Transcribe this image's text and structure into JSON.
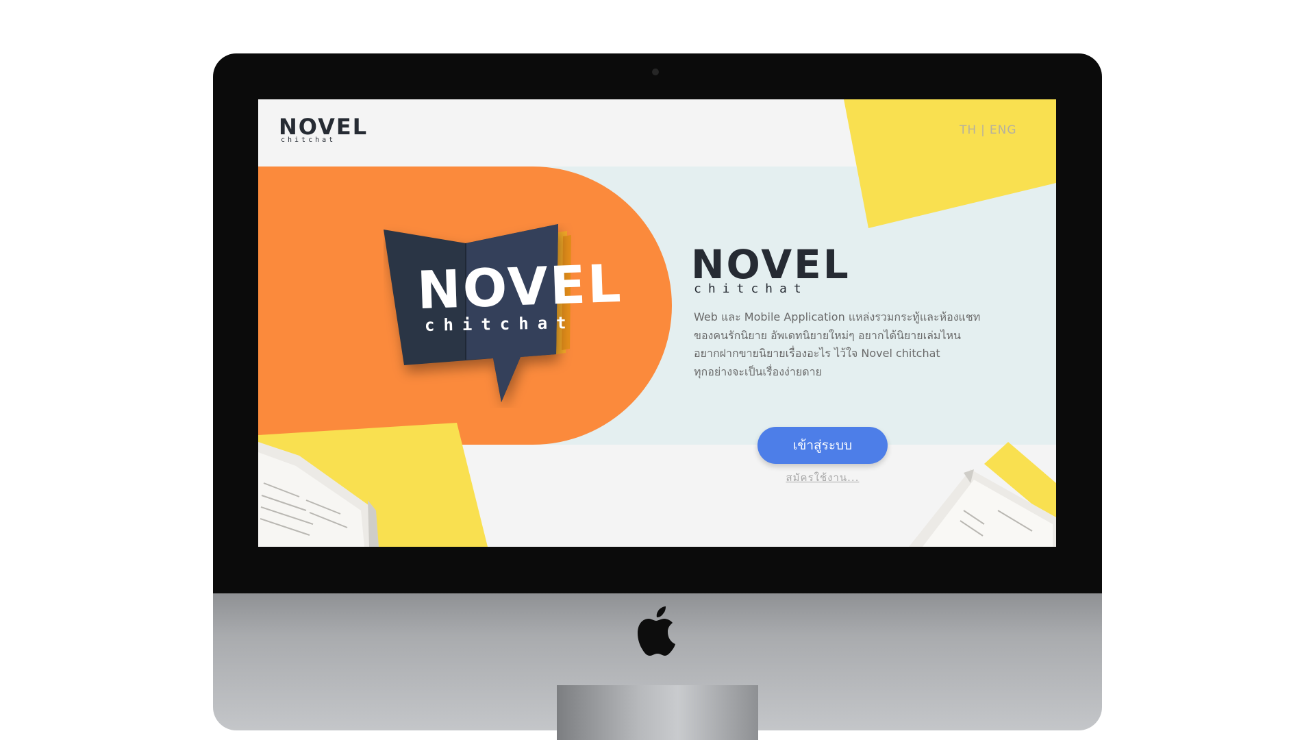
{
  "device": {
    "icons": {
      "camera": "camera-dot",
      "logo": "apple-logo-icon"
    }
  },
  "screen": {
    "brand": {
      "name": "NOVEL",
      "subtitle": "chitchat"
    },
    "language": {
      "th": "TH",
      "separator": "|",
      "eng": "ENG"
    },
    "hero": {
      "book_logo": {
        "name": "NOVEL",
        "subtitle": "chitchat"
      },
      "brand": {
        "name": "NOVEL",
        "subtitle": "chitchat"
      },
      "description": [
        "Web และ Mobile Application แหล่งรวมกระทู้และห้องแชท",
        "ของคนรักนิยาย  อัพเดทนิยายใหม่ๆ อยากได้นิยายเล่มไหน",
        "อยากฝากขายนิยายเรื่องอะไร ไว้ใจ Novel chitchat",
        "ทุกอย่างจะเป็นเรื่องง่ายดาย"
      ],
      "login_button": "เข้าสู่ระบบ",
      "signup_link": "สมัครใช้งาน..."
    },
    "colors": {
      "orange": "#fb8a3c",
      "yellow": "#f9e050",
      "navy": "#2a3444",
      "band": "#e4eff0",
      "button": "#4d7ee8"
    }
  }
}
